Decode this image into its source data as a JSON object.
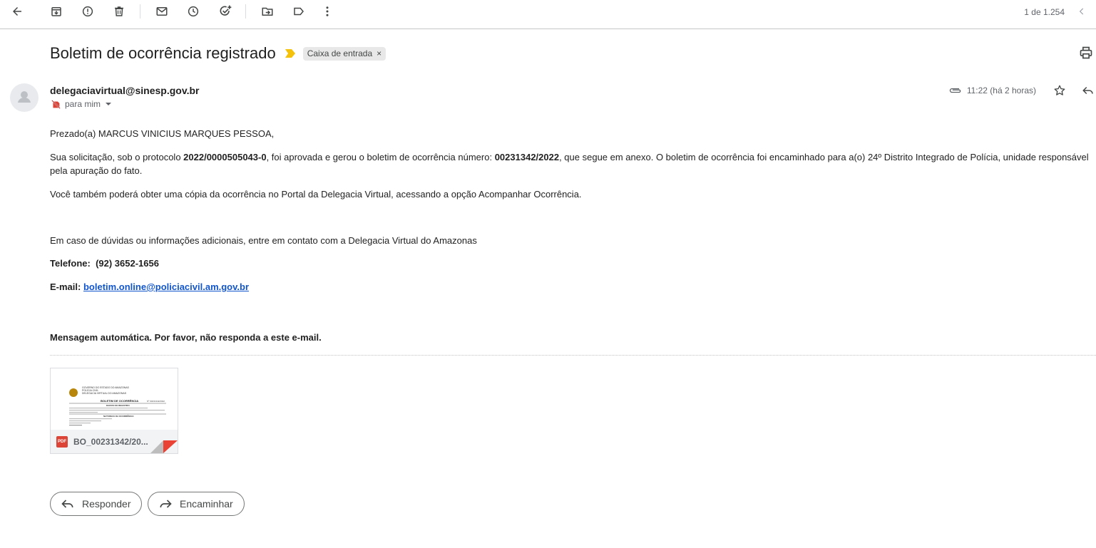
{
  "toolbar": {
    "icons": [
      "back-arrow-icon",
      "archive-icon",
      "report-spam-icon",
      "delete-icon",
      "mark-unread-icon",
      "snooze-icon",
      "add-to-tasks-icon",
      "move-to-icon",
      "label-icon",
      "more-options-icon"
    ],
    "pager": "1 de 1.254"
  },
  "email": {
    "subject": "Boletim de ocorrência registrado",
    "label_chip": "Caixa de entrada",
    "label_remove": "×",
    "sender": "delegaciavirtual@sinesp.gov.br",
    "recipient": "para mim",
    "time": "11:22 (há 2 horas)"
  },
  "body": {
    "greeting": "Prezado(a) MARCUS VINICIUS MARQUES PESSOA,",
    "p2_a": "Sua solicitação, sob o protocolo ",
    "protocol": "2022/0000505043-0",
    "p2_b": ", foi aprovada e gerou o boletim de ocorrência número: ",
    "bo_number": "00231342/2022",
    "p2_c": ", que segue em anexo. O boletim de ocorrência foi encaminhado para a(o) 24º Distrito Integrado de Polícia, unidade responsável pela apuração do fato.",
    "p3": "Você também poderá obter uma cópia da ocorrência no Portal da Delegacia Virtual, acessando a opção Acompanhar Ocorrência.",
    "p4": "Em caso de dúvidas ou informações adicionais, entre em contato com a Delegacia Virtual do Amazonas",
    "phone_label": "Telefone:",
    "phone": "(92) 3652-1656",
    "email_label": "E-mail:",
    "email_link": "boletim.online@policiacivil.am.gov.br",
    "auto_message": "Mensagem automática. Por favor, não responda a este e-mail."
  },
  "attachment": {
    "type_badge": "PDF",
    "name": "BO_00231342/20...",
    "preview": {
      "header_1": "GOVERNO DO ESTADO DO AMAZONAS",
      "header_2": "POLÍCIA CIVIL",
      "header_3": "DELEGACIA VIRTUAL DO AMAZONAS",
      "doc_title": "BOLETIM DE OCORRÊNCIA",
      "doc_number": "Nº 00231342/2022",
      "section_1": "DADOS DO REGISTRO",
      "section_2": "NATUREZA DA OCORRÊNCIA"
    }
  },
  "actions": {
    "reply": "Responder",
    "forward": "Encaminhar"
  },
  "colors": {
    "link": "#1155cc",
    "importance": "#f4c20d",
    "pdf": "#db4437"
  }
}
